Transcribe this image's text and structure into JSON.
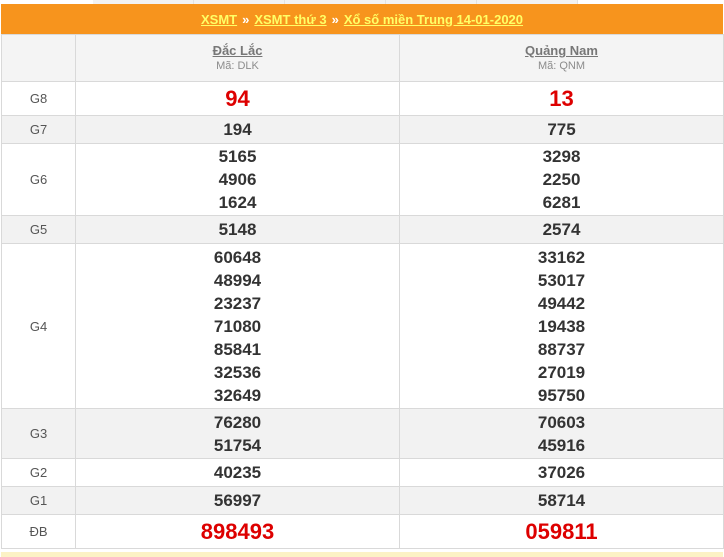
{
  "header": {
    "crumb_1": "XSMT",
    "crumb_2": "XSMT thứ 3",
    "crumb_3": "Xổ số miền Trung 14-01-2020",
    "separator": "»"
  },
  "provinces": [
    {
      "name": "Đắc Lắc",
      "code": "Mã: DLK"
    },
    {
      "name": "Quảng Nam",
      "code": "Mã: QNM"
    }
  ],
  "prizes": [
    {
      "label": "G8",
      "p1": [
        "94"
      ],
      "p2": [
        "13"
      ]
    },
    {
      "label": "G7",
      "p1": [
        "194"
      ],
      "p2": [
        "775"
      ]
    },
    {
      "label": "G6",
      "p1": [
        "5165",
        "4906",
        "1624"
      ],
      "p2": [
        "3298",
        "2250",
        "6281"
      ]
    },
    {
      "label": "G5",
      "p1": [
        "5148"
      ],
      "p2": [
        "2574"
      ]
    },
    {
      "label": "G4",
      "p1": [
        "60648",
        "48994",
        "23237",
        "71080",
        "85841",
        "32536",
        "32649"
      ],
      "p2": [
        "33162",
        "53017",
        "49442",
        "19438",
        "88737",
        "27019",
        "95750"
      ]
    },
    {
      "label": "G3",
      "p1": [
        "76280",
        "51754"
      ],
      "p2": [
        "70603",
        "45916"
      ]
    },
    {
      "label": "G2",
      "p1": [
        "40235"
      ],
      "p2": [
        "37026"
      ]
    },
    {
      "label": "G1",
      "p1": [
        "56997"
      ],
      "p2": [
        "58714"
      ]
    },
    {
      "label": "ĐB",
      "p1": [
        "898493"
      ],
      "p2": [
        "059811"
      ]
    }
  ],
  "colors": {
    "header_bg": "#f7941d",
    "header_text": "#ffff66",
    "prize_red": "#dd0000"
  }
}
